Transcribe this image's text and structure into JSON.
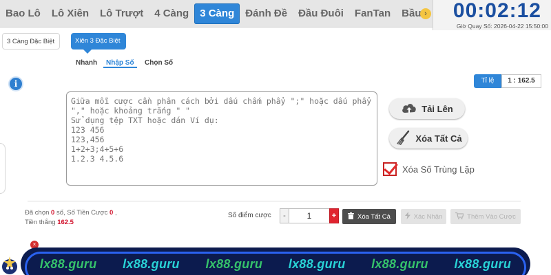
{
  "tabs": [
    "Bao Lô",
    "Lô Xiên",
    "Lô Trượt",
    "4 Càng",
    "3 Càng",
    "Đánh Đề",
    "Đầu Đuôi",
    "FanTan",
    "Bầu"
  ],
  "active_tab_index": 4,
  "timer": {
    "countdown": "00:02:12",
    "draw_time": "Giờ Quay Số: 2026-04-22 15:50:00"
  },
  "subtabs": [
    "3 Càng Đặc Biệt",
    "Xiên 3 Đặc Biệt"
  ],
  "modes": [
    "Nhanh",
    "Nhập Số",
    "Chọn Số"
  ],
  "ratio": {
    "label": "Tỉ lệ",
    "value": "1 : 162.5"
  },
  "input": {
    "placeholder": "Giữa mỗi cược cần phân cách bởi dấu chấm phẩy \";\" hoặc dấu phẩy\n\",\" hoặc khoảng trắng \" \"\nSử dụng tệp TXT hoặc dán Ví dụ:\n123 456\n123,456\n1+2+3;4+5+6\n1.2.3 4.5.6"
  },
  "actions": {
    "upload": "Tải Lên",
    "clear_all": "Xóa Tất Cả",
    "remove_duplicates": "Xóa Số Trùng Lặp"
  },
  "stats": {
    "selected_label": "Đã chọn",
    "selected_count": "0",
    "selected_unit": "số,",
    "bet_amount_label": "Số Tiền Cược",
    "bet_amount": "0",
    "bet_sep": ",",
    "win_label": "Tiền thắng",
    "win_amount": "162.5"
  },
  "points": {
    "label": "Số điểm cược",
    "minus": "-",
    "value": "1",
    "plus": "+"
  },
  "bottom_buttons": {
    "delete_all": "Xóa Tất Cả",
    "confirm": "Xác Nhận",
    "add_to_cart": "Thêm Vào Cược"
  },
  "banner": [
    "lx88.guru",
    "lx88.guru",
    "lx88.guru",
    "lx88.guru",
    "lx88.guru",
    "lx88.guru"
  ],
  "colors": {
    "accent": "#2f86d8",
    "timer": "#1b4fa0",
    "danger": "#e0242f",
    "banner_bg": "#0c1b4e"
  }
}
